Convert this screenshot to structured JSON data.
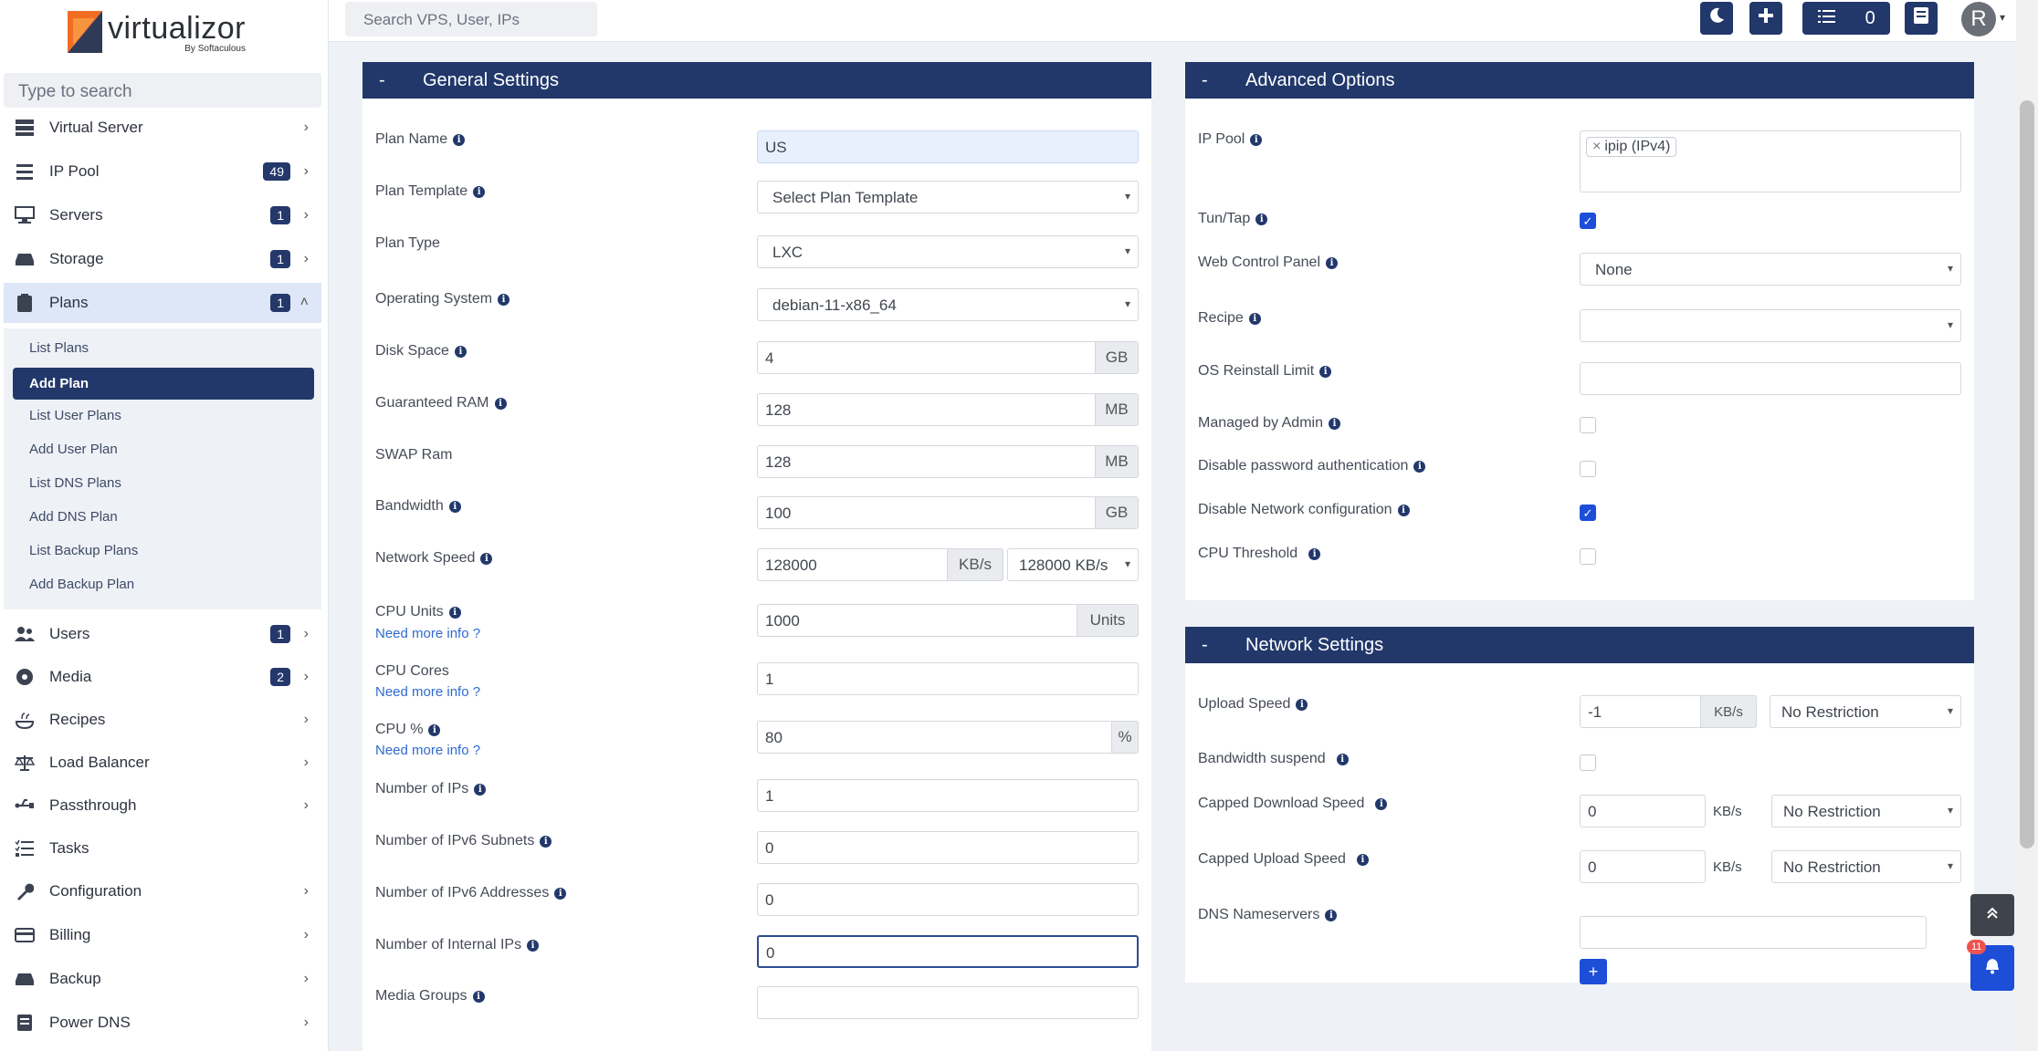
{
  "logo": {
    "name": "virtualizor",
    "sub": "By Softaculous"
  },
  "sidebar": {
    "search_placeholder": "Type to search",
    "items": [
      {
        "label": "Virtual Server",
        "badge": ""
      },
      {
        "label": "IP Pool",
        "badge": "49"
      },
      {
        "label": "Servers",
        "badge": "1"
      },
      {
        "label": "Storage",
        "badge": "1"
      },
      {
        "label": "Plans",
        "badge": "1"
      },
      {
        "label": "Users",
        "badge": "1"
      },
      {
        "label": "Media",
        "badge": "2"
      },
      {
        "label": "Recipes",
        "badge": ""
      },
      {
        "label": "Load Balancer",
        "badge": ""
      },
      {
        "label": "Passthrough",
        "badge": ""
      },
      {
        "label": "Tasks",
        "badge": ""
      },
      {
        "label": "Configuration",
        "badge": ""
      },
      {
        "label": "Billing",
        "badge": ""
      },
      {
        "label": "Backup",
        "badge": ""
      },
      {
        "label": "Power DNS",
        "badge": ""
      }
    ],
    "plans_submenu": [
      "List Plans",
      "Add Plan",
      "List User Plans",
      "Add User Plan",
      "List DNS Plans",
      "Add DNS Plan",
      "List Backup Plans",
      "Add Backup Plan"
    ]
  },
  "topbar": {
    "search_placeholder": "Search VPS, User, IPs",
    "tasks_count": "0",
    "avatar_initial": "R"
  },
  "general": {
    "title": "General Settings",
    "collapse": "-",
    "plan_name_label": "Plan Name",
    "plan_name": "US",
    "plan_template_label": "Plan Template",
    "plan_template": "Select Plan Template",
    "plan_type_label": "Plan Type",
    "plan_type": "LXC",
    "os_label": "Operating System",
    "os": "debian-11-x86_64",
    "disk_label": "Disk Space",
    "disk": "4",
    "disk_unit": "GB",
    "ram_label": "Guaranteed RAM",
    "ram": "128",
    "ram_unit": "MB",
    "swap_label": "SWAP Ram",
    "swap": "128",
    "swap_unit": "MB",
    "bw_label": "Bandwidth",
    "bw": "100",
    "bw_unit": "GB",
    "netspeed_label": "Network Speed",
    "netspeed": "128000",
    "netspeed_unit": "KB/s",
    "netspeed_select": "128000 KB/s",
    "cpu_units_label": "CPU Units",
    "cpu_units": "1000",
    "cpu_units_unit": "Units",
    "cpu_cores_label": "CPU Cores",
    "cpu_cores": "1",
    "cpu_pct_label": "CPU %",
    "cpu_pct": "80",
    "cpu_pct_unit": "%",
    "need_info": "Need more info ?",
    "ips_label": "Number of IPs",
    "ips": "1",
    "ipv6_subnets_label": "Number of IPv6 Subnets",
    "ipv6_subnets": "0",
    "ipv6_addr_label": "Number of IPv6 Addresses",
    "ipv6_addr": "0",
    "internal_ips_label": "Number of Internal IPs",
    "internal_ips": "0",
    "media_groups_label": "Media Groups",
    "media_groups": ""
  },
  "advanced": {
    "title": "Advanced Options",
    "collapse": "-",
    "ip_pool_label": "IP Pool",
    "ip_pool_tag": "ipip (IPv4)",
    "ip_pool_remove": "×",
    "tuntap_label": "Tun/Tap",
    "wcp_label": "Web Control Panel",
    "wcp": "None",
    "recipe_label": "Recipe",
    "os_reinstall_label": "OS Reinstall Limit",
    "managed_label": "Managed by Admin",
    "disable_pw_label": "Disable password authentication",
    "disable_net_label": "Disable Network configuration",
    "cpu_threshold_label": "CPU Threshold"
  },
  "network": {
    "title": "Network Settings",
    "collapse": "-",
    "upload_label": "Upload Speed",
    "upload": "-1",
    "upload_unit": "KB/s",
    "upload_select": "No Restriction",
    "bw_suspend_label": "Bandwidth suspend",
    "capped_down_label": "Capped Download Speed",
    "capped_down": "0",
    "capped_down_unit": "KB/s",
    "capped_down_select": "No Restriction",
    "capped_up_label": "Capped Upload Speed",
    "capped_up": "0",
    "capped_up_unit": "KB/s",
    "capped_up_select": "No Restriction",
    "dns_label": "DNS Nameservers",
    "add_btn": "+"
  },
  "notif_count": "11"
}
